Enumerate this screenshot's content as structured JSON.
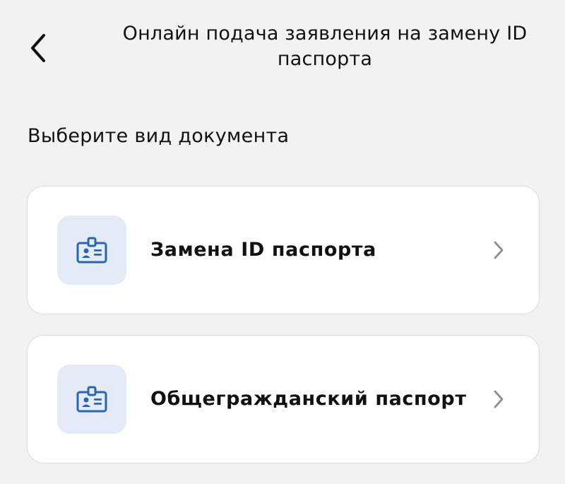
{
  "header": {
    "back_icon": "chevron-left-icon",
    "title": "Онлайн подача заявления на замену ID паспорта"
  },
  "main": {
    "section_heading": "Выберите вид документа",
    "options": [
      {
        "label": "Замена ID паспорта",
        "icon": "id-badge-icon",
        "chevron": "chevron-right-icon"
      },
      {
        "label": "Общегражданский паспорт",
        "icon": "id-badge-icon",
        "chevron": "chevron-right-icon"
      }
    ]
  },
  "colors": {
    "background": "#f2f2f2",
    "card_background": "#ffffff",
    "icon_tile": "#e4ebf6",
    "icon_accent": "#2b65b0",
    "chevron": "#8e8e93",
    "text": "#111111"
  }
}
